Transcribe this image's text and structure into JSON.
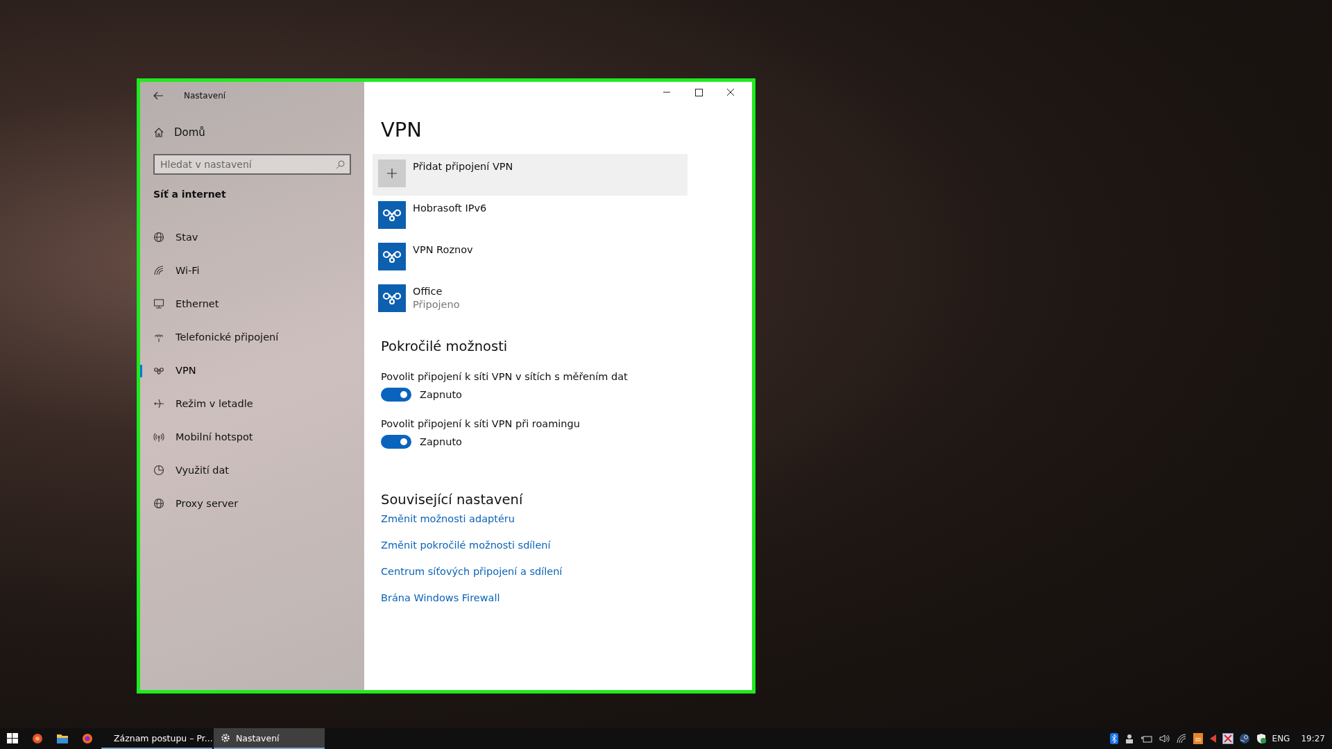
{
  "window": {
    "title": "Nastavení"
  },
  "sidebar": {
    "home": "Domů",
    "search": {
      "placeholder": "Hledat v nastavení"
    },
    "section": "Síť a internet",
    "items": [
      {
        "label": "Stav",
        "selected": false
      },
      {
        "label": "Wi-Fi",
        "selected": false
      },
      {
        "label": "Ethernet",
        "selected": false
      },
      {
        "label": "Telefonické připojení",
        "selected": false
      },
      {
        "label": "VPN",
        "selected": true
      },
      {
        "label": "Režim v letadle",
        "selected": false
      },
      {
        "label": "Mobilní hotspot",
        "selected": false
      },
      {
        "label": "Využití dat",
        "selected": false
      },
      {
        "label": "Proxy server",
        "selected": false
      }
    ]
  },
  "page": {
    "title": "VPN",
    "add_button": "Přidat připojení VPN",
    "connections": [
      {
        "name": "Hobrasoft IPv6"
      },
      {
        "name": "VPN Roznov"
      },
      {
        "name": "Office",
        "status": "Připojeno"
      }
    ],
    "advanced": {
      "heading": "Pokročilé možnosti",
      "toggles": [
        {
          "label": "Povolit připojení k síti VPN v sítích s měřením dat",
          "on": true,
          "state": "Zapnuto"
        },
        {
          "label": "Povolit připojení k síti VPN při roamingu",
          "on": true,
          "state": "Zapnuto"
        }
      ]
    },
    "related": {
      "heading": "Související nastavení",
      "links": [
        "Změnit možnosti adaptéru",
        "Změnit pokročilé možnosti sdílení",
        "Centrum síťových připojení a sdílení",
        "Brána Windows Firewall"
      ]
    }
  },
  "taskbar": {
    "apps": [
      {
        "label": "Záznam postupu – Pr...",
        "selected": false
      },
      {
        "label": "Nastavení",
        "selected": true
      }
    ],
    "language": "ENG",
    "clock": "19:27"
  }
}
